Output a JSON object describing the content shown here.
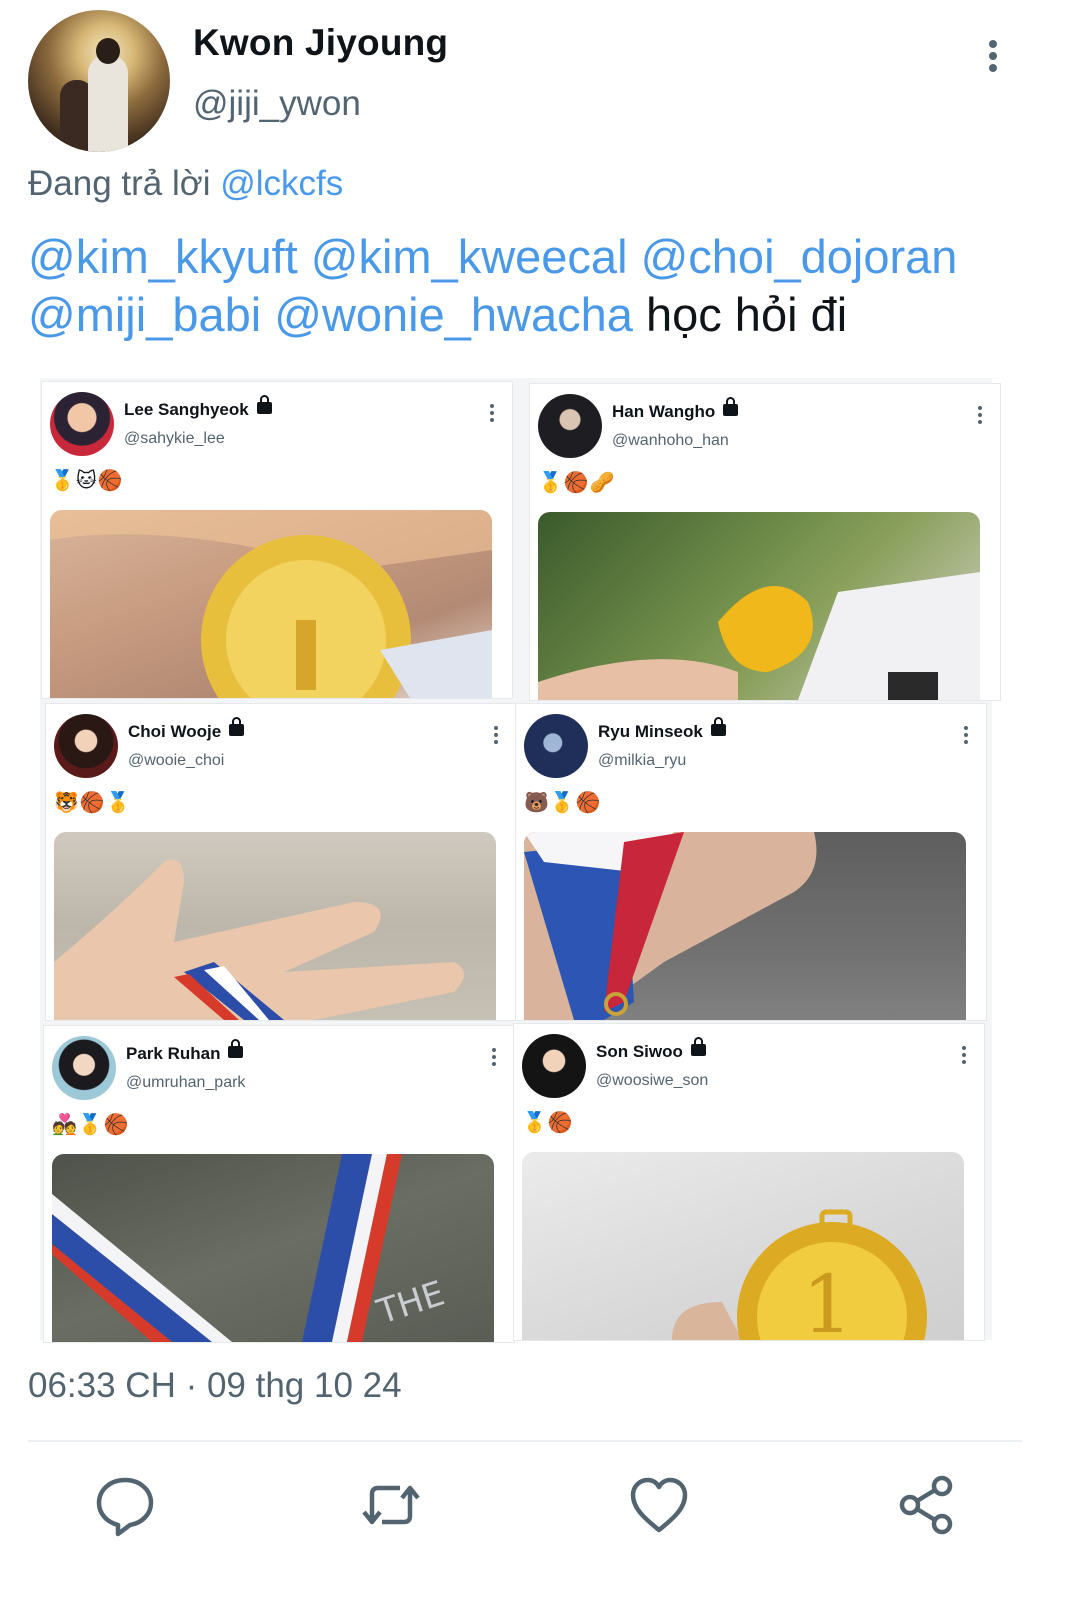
{
  "author": {
    "display_name": "Kwon Jiyoung",
    "handle": "@jiji_ywon"
  },
  "reply": {
    "prefix": "Đang trả lời",
    "target": "@lckcfs"
  },
  "tweet": {
    "mentions": [
      "@kim_kkyuft",
      "@kim_kweecal",
      "@choi_dojoran",
      "@miji_babi",
      "@wonie_hwacha"
    ],
    "text": "học hỏi đi"
  },
  "embedded_posts": [
    {
      "name": "Lee Sanghyeok",
      "handle": "@sahykie_lee",
      "emojis": "🥇🐱🏀"
    },
    {
      "name": "Han Wangho",
      "handle": "@wanhoho_han",
      "emojis": "🥇🏀🥜"
    },
    {
      "name": "Choi Wooje",
      "handle": "@wooie_choi",
      "emojis": "🐯🏀🥇"
    },
    {
      "name": "Ryu Minseok",
      "handle": "@milkia_ryu",
      "emojis": "🐻🥇🏀"
    },
    {
      "name": "Park Ruhan",
      "handle": "@umruhan_park",
      "emojis": "💑🥇🏀"
    },
    {
      "name": "Son Siwoo",
      "handle": "@woosiwe_son",
      "emojis": "🥇🏀"
    }
  ],
  "timestamp": "06:33 CH · 09 thg 10 24",
  "actions": [
    "reply-icon",
    "retweet-icon",
    "like-icon",
    "share-icon"
  ],
  "colors": {
    "mention": "#4a99e9",
    "secondary_text": "#536471",
    "primary_text": "#0f1419"
  }
}
